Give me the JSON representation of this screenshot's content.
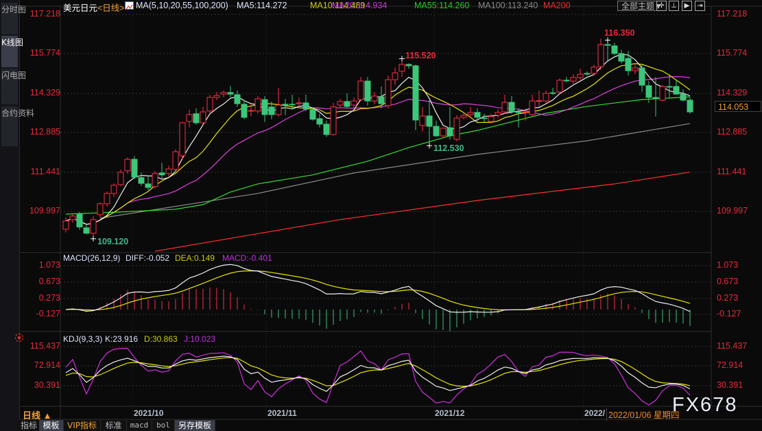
{
  "sidebar": {
    "tabs": [
      "分时图",
      "K线图",
      "闪电图",
      "合约资料"
    ],
    "active": 1
  },
  "header": {
    "title": "美元日元",
    "period": "<日线>",
    "ma_spec": "MA(5,10,20,55,100,200)",
    "ma5": "MA5:114.272",
    "ma10": "MA10:114.489",
    "ma20": "MA20:114.934",
    "ma55": "MA55:114.260",
    "ma100": "MA100:113.240",
    "ma200": "MA200",
    "theme_button": "全部主题▼"
  },
  "colors": {
    "up": "#ff2d48",
    "down": "#3cc67a",
    "ma5": "#f0f0f0",
    "ma10": "#e6e600",
    "ma20": "#e040e0",
    "ma55": "#33dd33",
    "ma100": "#8a8a8a",
    "ma200": "#ff3030",
    "axis": "#e8283a"
  },
  "price_axis": [
    "117.218",
    "115.774",
    "114.329",
    "112.885",
    "111.441",
    "109.997"
  ],
  "current_price": "114.053",
  "annotations": {
    "high1": "116.350",
    "high2": "115.520",
    "low1": "112.530",
    "low2": "109.120"
  },
  "macd": {
    "label": "MACD(26,12,9)",
    "diff": "DIFF:-0.052",
    "dea": "DEA:0.149",
    "macd": "MACD:-0.401",
    "axis": [
      "1.073",
      "0.673",
      "0.273",
      "-0.127"
    ]
  },
  "kdj": {
    "label": "KDJ(9,3,3)",
    "k": "K:23.916",
    "d": "D:30.863",
    "j": "J:10.023",
    "axis": [
      "115.437",
      "72.914",
      "30.391"
    ]
  },
  "time_axis": {
    "period_label": "日线 ▲",
    "months": [
      "2021/10",
      "2021/11",
      "2021/12",
      "2022/"
    ],
    "cursor_date": "2022/01/06 星期四"
  },
  "bottom_tabs": [
    "指标",
    "模板",
    "VIP指标",
    "标准",
    "macd",
    "bol",
    "另存模板"
  ],
  "watermark": "FX678",
  "chart_data": {
    "type": "candlestick",
    "title": "美元日元 日线",
    "ylim": [
      108.4,
      117.4
    ],
    "candles_ohlc": [
      [
        109.37,
        109.8,
        109.25,
        109.67
      ],
      [
        109.72,
        109.95,
        109.6,
        109.85
      ],
      [
        109.92,
        110.0,
        109.35,
        109.45
      ],
      [
        109.42,
        109.55,
        109.18,
        109.22
      ],
      [
        109.22,
        109.85,
        109.12,
        109.72
      ],
      [
        109.9,
        110.35,
        109.8,
        110.3
      ],
      [
        110.3,
        110.75,
        110.2,
        110.68
      ],
      [
        110.68,
        111.05,
        110.55,
        110.98
      ],
      [
        111.0,
        111.55,
        110.95,
        111.46
      ],
      [
        111.51,
        112.0,
        111.4,
        111.93
      ],
      [
        111.93,
        112.05,
        111.2,
        111.28
      ],
      [
        111.26,
        111.45,
        110.95,
        111.05
      ],
      [
        111.03,
        111.3,
        110.8,
        110.9
      ],
      [
        110.93,
        111.5,
        110.85,
        111.41
      ],
      [
        111.43,
        111.8,
        111.2,
        111.36
      ],
      [
        111.41,
        111.7,
        111.3,
        111.58
      ],
      [
        111.56,
        112.3,
        111.45,
        112.21
      ],
      [
        112.06,
        113.3,
        111.95,
        113.27
      ],
      [
        113.32,
        113.75,
        113.1,
        113.57
      ],
      [
        113.6,
        113.8,
        113.2,
        113.27
      ],
      [
        113.27,
        113.85,
        113.2,
        113.67
      ],
      [
        113.7,
        114.3,
        113.6,
        114.2
      ],
      [
        114.2,
        114.4,
        114.1,
        114.27
      ],
      [
        114.32,
        114.45,
        114.2,
        114.38
      ],
      [
        114.38,
        114.62,
        114.2,
        114.32
      ],
      [
        114.3,
        114.45,
        113.85,
        113.97
      ],
      [
        113.95,
        114.1,
        113.4,
        113.47
      ],
      [
        113.7,
        113.95,
        113.5,
        113.72
      ],
      [
        113.7,
        114.25,
        113.6,
        114.15
      ],
      [
        114.12,
        114.25,
        113.3,
        113.57
      ],
      [
        113.85,
        114.05,
        113.4,
        113.57
      ],
      [
        113.57,
        114.55,
        113.5,
        113.92
      ],
      [
        113.95,
        114.15,
        113.55,
        113.92
      ],
      [
        113.95,
        114.3,
        113.75,
        113.93
      ],
      [
        113.97,
        114.2,
        113.85,
        114.0
      ],
      [
        114.0,
        114.3,
        113.7,
        113.77
      ],
      [
        113.75,
        113.85,
        113.35,
        113.4
      ],
      [
        113.42,
        113.6,
        113.1,
        113.22
      ],
      [
        113.22,
        113.35,
        112.75,
        112.84
      ],
      [
        112.84,
        114.0,
        112.8,
        113.85
      ],
      [
        113.92,
        114.15,
        113.8,
        114.05
      ],
      [
        114.05,
        114.35,
        113.8,
        113.87
      ],
      [
        113.92,
        114.2,
        113.8,
        114.07
      ],
      [
        114.12,
        114.95,
        114.05,
        114.8
      ],
      [
        114.8,
        114.95,
        113.9,
        114.07
      ],
      [
        114.07,
        114.4,
        113.95,
        114.25
      ],
      [
        114.22,
        114.6,
        113.8,
        113.97
      ],
      [
        113.9,
        115.0,
        113.8,
        114.85
      ],
      [
        114.85,
        115.3,
        114.65,
        115.1
      ],
      [
        115.16,
        115.52,
        114.95,
        115.41
      ],
      [
        115.41,
        115.45,
        115.25,
        115.36
      ],
      [
        115.36,
        115.4,
        113.0,
        113.37
      ],
      [
        113.17,
        113.85,
        112.95,
        113.52
      ],
      [
        113.52,
        114.1,
        112.53,
        113.14
      ],
      [
        113.14,
        113.35,
        112.75,
        112.79
      ],
      [
        112.79,
        113.1,
        112.7,
        113.07
      ],
      [
        113.09,
        113.85,
        112.65,
        112.79
      ],
      [
        112.66,
        113.55,
        112.6,
        113.44
      ],
      [
        113.47,
        113.65,
        113.4,
        113.54
      ],
      [
        113.57,
        113.85,
        113.5,
        113.65
      ],
      [
        113.65,
        113.8,
        113.3,
        113.47
      ],
      [
        113.45,
        113.6,
        113.3,
        113.44
      ],
      [
        113.32,
        113.6,
        113.25,
        113.5
      ],
      [
        113.55,
        113.75,
        113.45,
        113.65
      ],
      [
        113.67,
        114.3,
        113.6,
        114.02
      ],
      [
        114.02,
        114.25,
        113.6,
        113.67
      ],
      [
        113.67,
        113.8,
        113.1,
        113.66
      ],
      [
        113.66,
        113.8,
        113.35,
        113.67
      ],
      [
        113.57,
        114.3,
        113.5,
        114.07
      ],
      [
        114.07,
        114.45,
        113.85,
        114.08
      ],
      [
        114.07,
        114.45,
        114.0,
        114.35
      ],
      [
        114.37,
        114.55,
        114.3,
        114.36
      ],
      [
        114.4,
        114.9,
        114.35,
        114.83
      ],
      [
        114.83,
        114.95,
        114.75,
        114.82
      ],
      [
        114.8,
        115.05,
        114.7,
        114.93
      ],
      [
        114.93,
        115.25,
        114.85,
        115.05
      ],
      [
        115.08,
        115.15,
        115.0,
        115.07
      ],
      [
        115.08,
        115.4,
        115.0,
        115.31
      ],
      [
        115.33,
        116.35,
        115.2,
        116.14
      ],
      [
        116.14,
        116.2,
        115.55,
        116.11
      ],
      [
        116.09,
        116.2,
        115.75,
        115.81
      ],
      [
        115.81,
        115.95,
        115.45,
        115.53
      ],
      [
        115.63,
        115.9,
        115.0,
        115.18
      ],
      [
        115.18,
        115.45,
        115.05,
        115.28
      ],
      [
        115.28,
        115.4,
        114.4,
        114.65
      ],
      [
        114.63,
        114.8,
        114.0,
        114.2
      ],
      [
        114.2,
        114.95,
        113.5,
        114.17
      ],
      [
        114.1,
        114.65,
        114.05,
        114.6
      ],
      [
        114.6,
        115.0,
        114.2,
        114.59
      ],
      [
        114.6,
        114.85,
        114.3,
        114.32
      ],
      [
        114.32,
        114.5,
        114.05,
        114.1
      ],
      [
        114.1,
        114.2,
        113.6,
        113.67
      ]
    ],
    "ma55_points": [
      [
        0,
        109.92
      ],
      [
        8,
        110.0
      ],
      [
        16,
        110.1
      ],
      [
        20,
        110.27
      ],
      [
        24,
        110.73
      ],
      [
        28,
        111.03
      ],
      [
        36,
        111.36
      ],
      [
        44,
        111.86
      ],
      [
        50,
        112.36
      ],
      [
        56,
        112.79
      ],
      [
        60,
        112.99
      ],
      [
        70,
        113.62
      ],
      [
        76,
        113.87
      ],
      [
        84,
        114.12
      ],
      [
        91,
        114.22
      ]
    ],
    "ma100_points": [
      [
        5,
        109.77
      ],
      [
        28,
        110.68
      ],
      [
        42,
        111.43
      ],
      [
        60,
        112.11
      ],
      [
        76,
        112.61
      ],
      [
        91,
        113.24
      ]
    ],
    "ma200_points": [
      [
        13,
        108.56
      ],
      [
        40,
        109.72
      ],
      [
        60,
        110.42
      ],
      [
        80,
        111.03
      ],
      [
        91,
        111.46
      ]
    ],
    "macd_params": [
      26,
      12,
      9
    ],
    "kdj_params": [
      9,
      3,
      3
    ]
  }
}
